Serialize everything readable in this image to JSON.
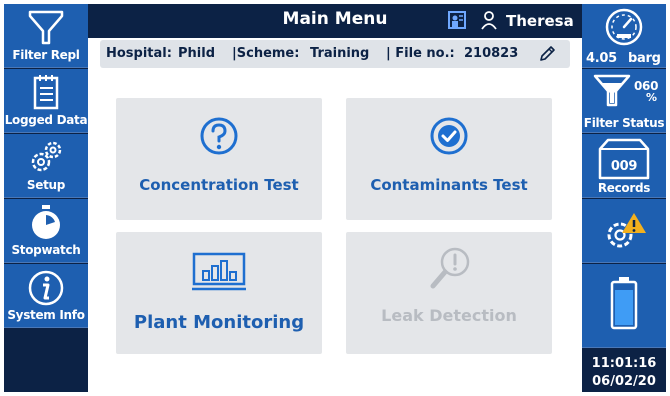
{
  "header": {
    "title": "Main Menu",
    "user": "Theresa"
  },
  "info_bar": {
    "hospital_label": "Hospital:",
    "hospital_value": "Phild",
    "scheme_label": "|Scheme:",
    "scheme_value": "Training",
    "file_label": "| File no.:",
    "file_value": "210823"
  },
  "left_sidebar": {
    "items": [
      {
        "label": "Filter Repl",
        "icon": "filter-replace-icon"
      },
      {
        "label": "Logged Data",
        "icon": "logged-data-icon"
      },
      {
        "label": "Setup",
        "icon": "setup-gear-icon"
      },
      {
        "label": "Stopwatch",
        "icon": "stopwatch-icon"
      },
      {
        "label": "System Info",
        "icon": "info-icon"
      }
    ]
  },
  "right_sidebar": {
    "pressure": {
      "value": "4.05",
      "unit": "barg"
    },
    "filter_status": {
      "percent": "060",
      "percent_sign": "%",
      "label": "Filter Status"
    },
    "records": {
      "count": "009",
      "label": "Records"
    },
    "warning": {
      "icon": "settings-warning-icon"
    },
    "battery": {
      "icon": "battery-icon"
    },
    "time": "11:01:16",
    "date": "06/02/20"
  },
  "tiles": [
    {
      "label": "Concentration Test",
      "icon": "question-icon",
      "enabled": true
    },
    {
      "label": "Contaminants Test",
      "icon": "check-icon",
      "enabled": true
    },
    {
      "label": "Plant Monitoring",
      "icon": "chart-monitor-icon",
      "enabled": true
    },
    {
      "label": "Leak Detection",
      "icon": "magnifier-alert-icon",
      "enabled": false
    }
  ],
  "colors": {
    "dark_navy": "#0c2245",
    "sidebar_blue": "#1e5fb0",
    "accent_blue": "#1e6fd0",
    "tile_gray": "#e4e6e9",
    "disabled_gray": "#b8bcc2",
    "warning_yellow": "#f2b01e"
  }
}
